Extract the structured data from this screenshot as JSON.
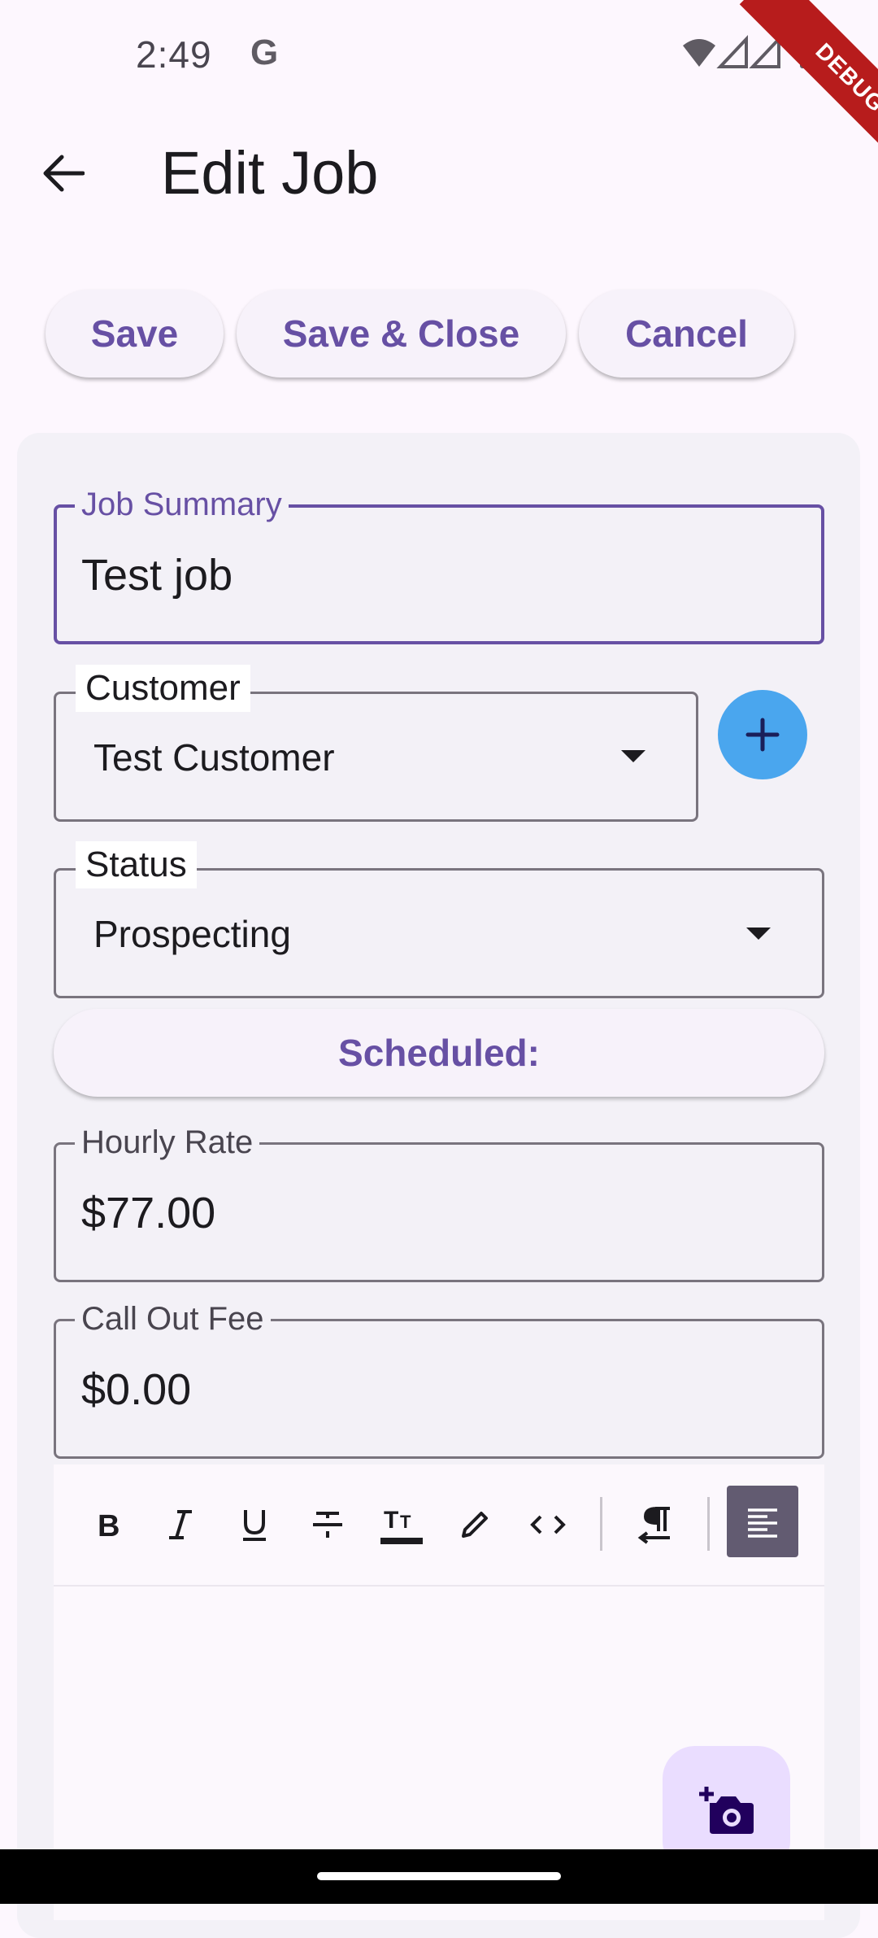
{
  "status_bar": {
    "time": "2:49",
    "google_glyph": "G",
    "debug_banner": "DEBUG"
  },
  "app_bar": {
    "title": "Edit Job",
    "back_icon": "arrow-back-icon"
  },
  "actions": {
    "save": "Save",
    "save_close": "Save & Close",
    "cancel": "Cancel"
  },
  "form": {
    "job_summary": {
      "label": "Job Summary",
      "value": "Test job"
    },
    "customer": {
      "label": "Customer",
      "value": "Test Customer"
    },
    "status": {
      "label": "Status",
      "value": "Prospecting"
    },
    "scheduled_label": "Scheduled:",
    "hourly_rate": {
      "label": "Hourly Rate",
      "value": "$77.00"
    },
    "call_out_fee": {
      "label": "Call Out Fee",
      "value": "$0.00"
    }
  },
  "editor_toolbar": {
    "tools": [
      "bold-icon",
      "italic-icon",
      "underline-icon",
      "strikethrough-icon",
      "text-size-icon",
      "highlight-pen-icon",
      "code-icon",
      "paragraph-direction-icon",
      "align-left-icon"
    ]
  },
  "colors": {
    "accent": "#6750a4",
    "fab_blue": "#4aa6ee",
    "debug_red": "#b71c1c"
  }
}
